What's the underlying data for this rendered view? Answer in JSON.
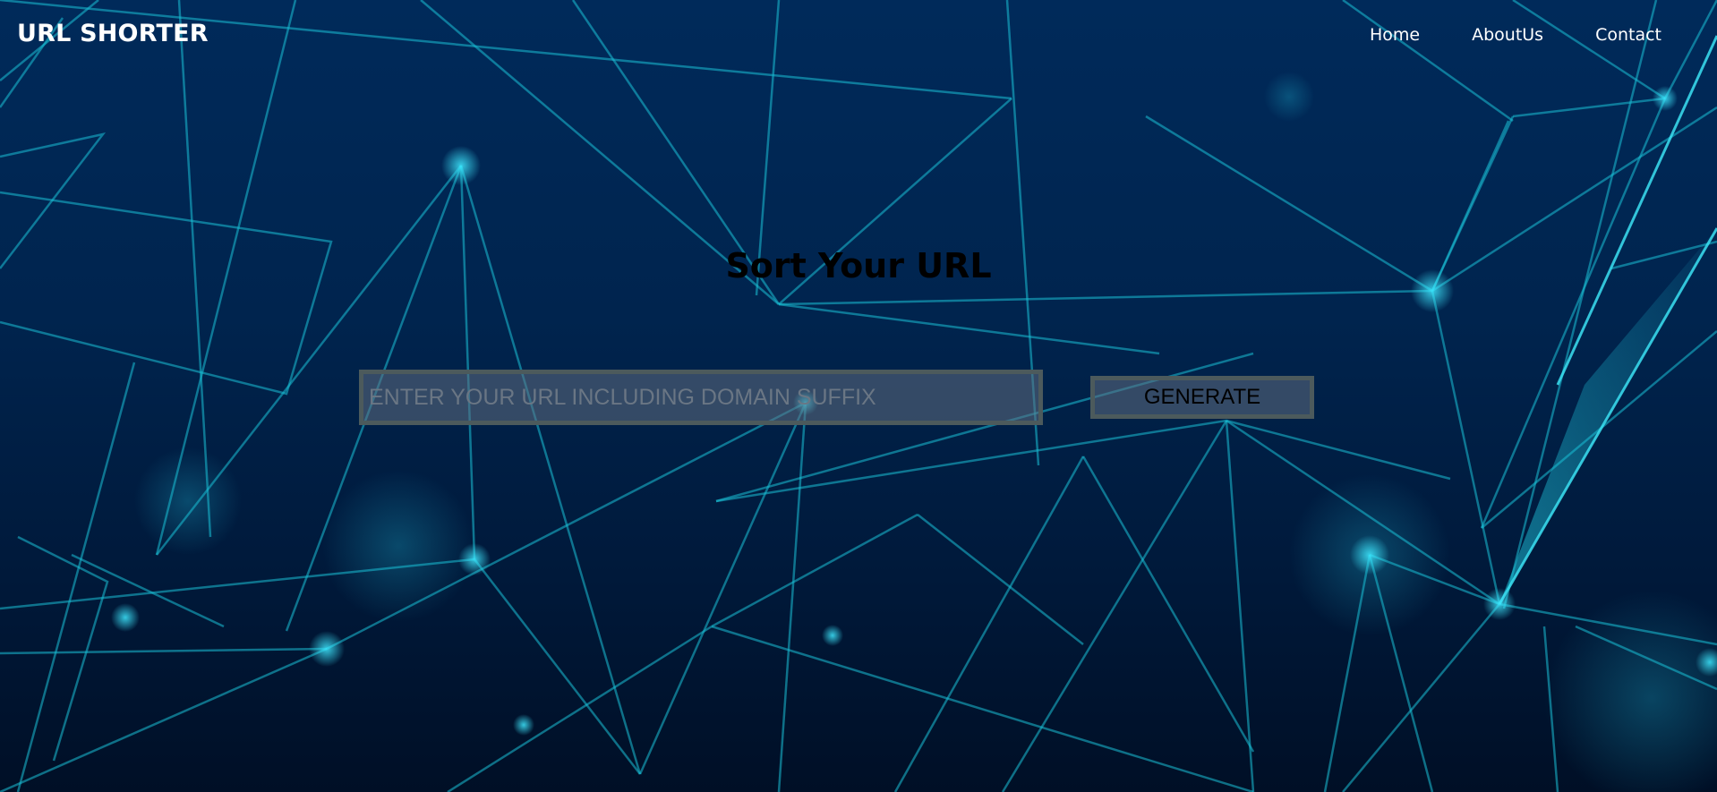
{
  "navbar": {
    "brand": "URL SHORTER",
    "links": [
      {
        "label": "Home"
      },
      {
        "label": "AboutUs"
      },
      {
        "label": "Contact"
      }
    ]
  },
  "main": {
    "title": "Sort Your URL",
    "url_input": {
      "value": "",
      "placeholder": "ENTER YOUR URL INCLUDING DOMAIN SUFFIX"
    },
    "generate_button": "GENERATE"
  },
  "colors": {
    "background_top": "#002a5a",
    "background_bottom": "#000f26",
    "network_lines": "#18c4d8",
    "text": "#ffffff"
  }
}
